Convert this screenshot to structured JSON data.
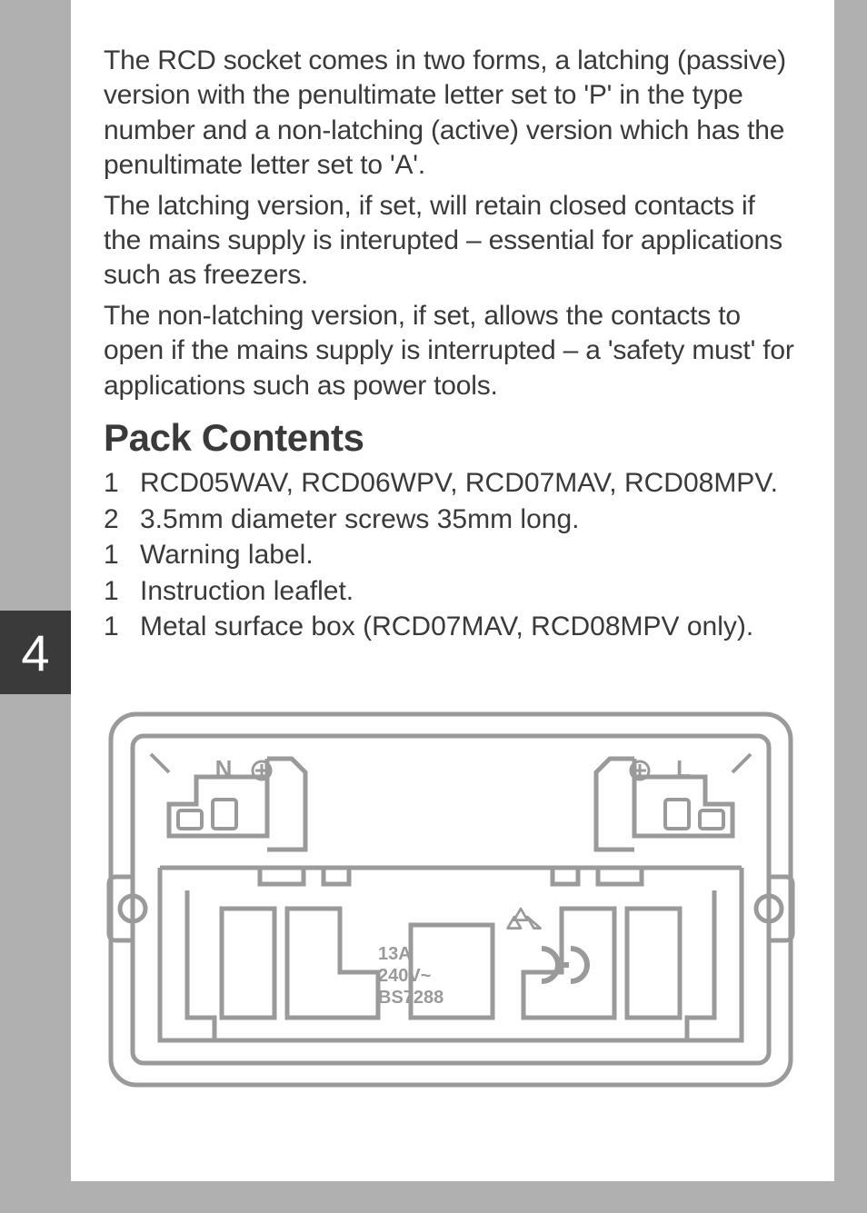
{
  "page_number": "4",
  "paragraphs": {
    "p1": "The RCD socket comes in two forms, a latching (passive) version with the penultimate letter set to 'P' in the type number and a non-latching (active) version which has the penultimate letter set to 'A'.",
    "p2": "The latching version, if set, will retain closed contacts if the mains supply is interupted – essential for applications such as freezers.",
    "p3": "The non-latching version, if set, allows the contacts to open if the mains supply is interrupted – a 'safety must' for applications such as power tools."
  },
  "heading": "Pack Contents",
  "pack_contents": [
    {
      "qty": "1",
      "item": "RCD05WAV, RCD06WPV, RCD07MAV, RCD08MPV."
    },
    {
      "qty": "2",
      "item": "3.5mm diameter screws 35mm long."
    },
    {
      "qty": "1",
      "item": "Warning label."
    },
    {
      "qty": "1",
      "item": "Instruction leaflet."
    },
    {
      "qty": "1",
      "item": "Metal surface box (RCD07MAV, RCD08MPV only)."
    }
  ],
  "diagram": {
    "label_neutral": "N",
    "label_live": "L",
    "rating_line1": "13A",
    "rating_line2": "240V~",
    "rating_line3": "BS7288",
    "ce_mark": "CE",
    "recycle_icon": "recycle"
  }
}
